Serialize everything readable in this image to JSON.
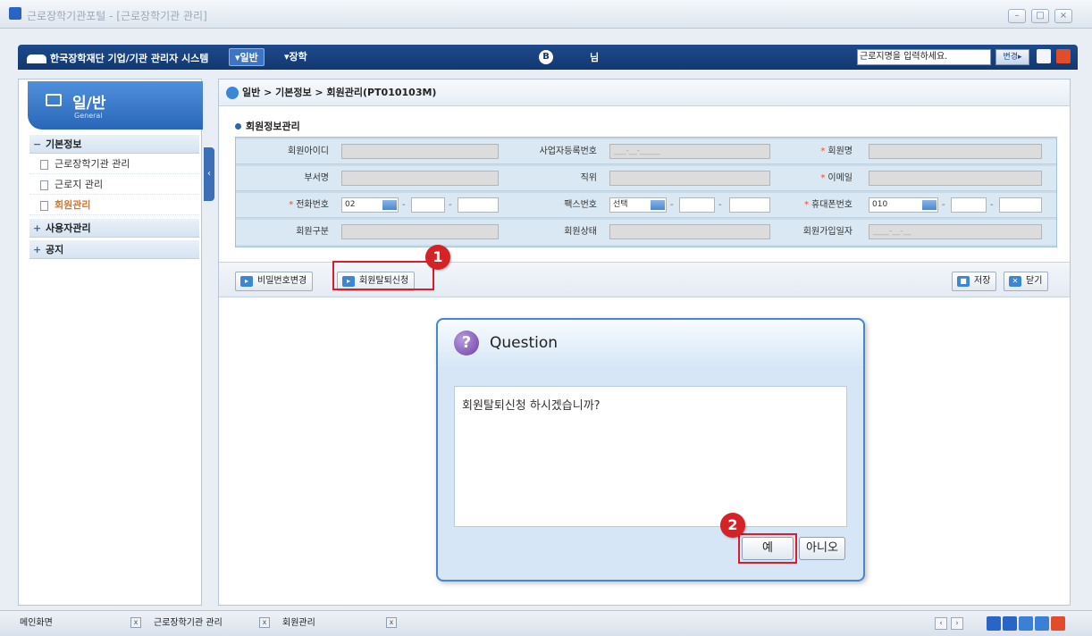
{
  "window": {
    "title": "근로장학기관포털 - [근로장학기관 관리]"
  },
  "header": {
    "logo_text": "한국장학재단 기업/기관 관리자 시스템",
    "tabs": [
      {
        "label": "▾일반"
      },
      {
        "label": "▾장학"
      }
    ],
    "center_mark": "B",
    "center_text": "님",
    "search_value": "근로지명을 입력하세요.",
    "search_button": "변경▸"
  },
  "sidebar": {
    "title": "일/반",
    "subtitle": "General",
    "groups": [
      {
        "sign": "−",
        "label": "기본정보"
      },
      {
        "sign": "+",
        "label": "사용자관리"
      },
      {
        "sign": "+",
        "label": "공지"
      }
    ],
    "items": [
      {
        "label": "근로장학기관 관리"
      },
      {
        "label": "근로지 관리"
      },
      {
        "label": "회원관리"
      }
    ],
    "toggle": "‹"
  },
  "breadcrumb": "일반 > 기본정보 > 회원관리(PT010103M)",
  "section_title": "회원정보관리",
  "form": {
    "member_id": "회원아이디",
    "biz_no": "사업자등록번호",
    "biz_no_value": "___-__-_____",
    "member_name": "회원명",
    "dept": "부서명",
    "position": "직위",
    "email": "이메일",
    "phone": "전화번호",
    "phone_prefix": "02",
    "fax": "팩스번호",
    "fax_select": "선택",
    "mobile": "휴대폰번호",
    "mobile_prefix": "010",
    "member_type": "회원구분",
    "member_status": "회원상태",
    "join_date": "회원가입일자",
    "join_date_value": "____-__-__",
    "dash": "-",
    "req": "*"
  },
  "buttons": {
    "change_password": "비밀번호변경",
    "withdraw": "회원탈퇴신청",
    "save": "저장",
    "close": "닫기"
  },
  "badges": {
    "one": "1",
    "two": "2"
  },
  "dialog": {
    "title": "Question",
    "icon": "?",
    "message": "회원탈퇴신청 하시겠습니까?",
    "yes": "예",
    "no": "아니오"
  },
  "taskbar": {
    "tabs": [
      {
        "label": "메인화면"
      },
      {
        "label": "근로장학기관 관리"
      },
      {
        "label": "회원관리"
      }
    ],
    "close_glyph": "x",
    "prev": "‹",
    "next": "›"
  }
}
